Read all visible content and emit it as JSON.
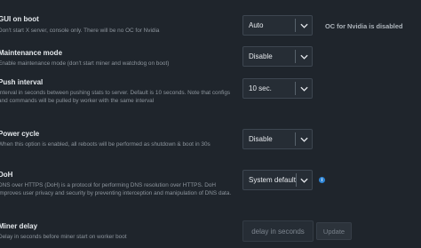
{
  "settings": [
    {
      "label": "GUI on boot",
      "desc": "Don't start X server, console only. There will be no OC for Nvidia",
      "value": "Auto",
      "note": "OC for Nvidia is disabled"
    },
    {
      "label": "Maintenance mode",
      "desc": "Enable maintenance mode (don't start miner and watchdog on boot)",
      "value": "Disable"
    },
    {
      "label": "Push interval",
      "desc": "Interval in seconds between pushing stats to server. Default is 10 seconds. Note that configs and commands will be pulled by worker with the same interval",
      "value": "10 sec."
    },
    {
      "label": "Power cycle",
      "desc": "When this option is enabled, all reboots will be performed as shutdown & boot in 30s",
      "value": "Disable"
    },
    {
      "label": "DoH",
      "desc": "DNS over HTTPS (DoH) is a protocol for performing DNS resolution over HTTPS. DoH improves user privacy and security by preventing interception and manipulation of DNS data.",
      "value": "System default",
      "info_icon": "i"
    },
    {
      "label": "Miner delay",
      "desc": "Delay in seconds before miner start on worker boot",
      "placeholder": "delay in seconds",
      "button": "Update"
    }
  ],
  "icons": {
    "dropdown": "chevron-down-icon",
    "info": "info-icon"
  },
  "colors": {
    "background": "#1f252c",
    "info": "#2f86d6"
  }
}
